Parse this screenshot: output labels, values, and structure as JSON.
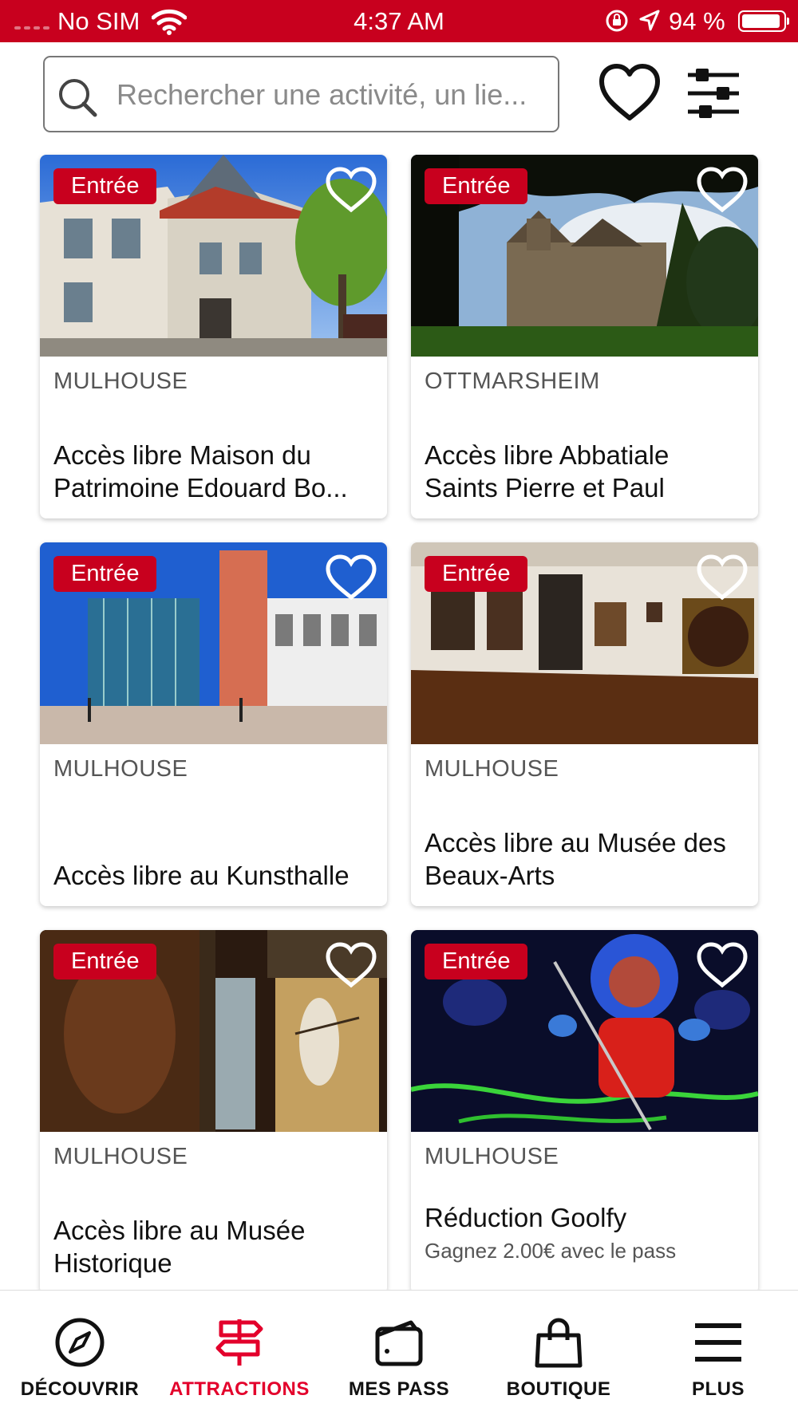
{
  "status_bar": {
    "carrier": "No SIM",
    "time": "4:37 AM",
    "battery": "94 %"
  },
  "search": {
    "placeholder": "Rechercher une activité, un lie..."
  },
  "cards": [
    {
      "badge": "Entrée",
      "city": "MULHOUSE",
      "title": "Accès libre Maison du Patrimoine Edouard Bo..."
    },
    {
      "badge": "Entrée",
      "city": "OTTMARSHEIM",
      "title": "Accès libre Abbatiale Saints Pierre et Paul"
    },
    {
      "badge": "Entrée",
      "city": "MULHOUSE",
      "title": "Accès libre au Kunsthalle"
    },
    {
      "badge": "Entrée",
      "city": "MULHOUSE",
      "title": "Accès libre au Musée des Beaux-Arts"
    },
    {
      "badge": "Entrée",
      "city": "MULHOUSE",
      "title": "Accès libre au Musée Historique"
    },
    {
      "badge": "Entrée",
      "city": "MULHOUSE",
      "title": "Réduction Goolfy",
      "subtitle": "Gagnez 2.00€ avec le pass"
    }
  ],
  "tabs": [
    {
      "label": "DÉCOUVRIR",
      "icon": "compass-icon"
    },
    {
      "label": "ATTRACTIONS",
      "icon": "signpost-icon",
      "active": true
    },
    {
      "label": "MES PASS",
      "icon": "wallet-icon"
    },
    {
      "label": "BOUTIQUE",
      "icon": "shopping-bag-icon"
    },
    {
      "label": "PLUS",
      "icon": "menu-icon"
    }
  ],
  "colors": {
    "brand": "#c8001e",
    "active_tab": "#e3002b"
  }
}
